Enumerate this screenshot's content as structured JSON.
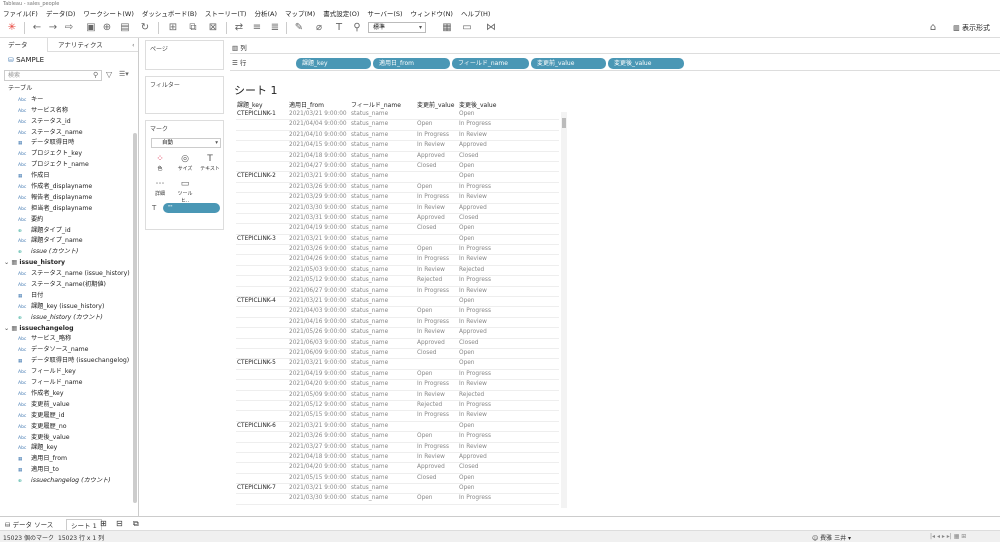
{
  "window_title": "Tableau - sales_people",
  "menu": [
    "ファイル(F)",
    "データ(D)",
    "ワークシート(W)",
    "ダッシュボード(B)",
    "ストーリー(T)",
    "分析(A)",
    "マップ(M)",
    "書式設定(O)",
    "サーバー(S)",
    "ウィンドウ(N)",
    "ヘルプ(H)"
  ],
  "toolbar": {
    "fit_select": "標準",
    "present_label": "表示形式"
  },
  "pane": {
    "tab_data": "データ",
    "tab_analytics": "アナリティクス",
    "datasource": "SAMPLE",
    "search_placeholder": "検索",
    "table_header": "テーブル"
  },
  "fields": [
    {
      "type": "Abc",
      "name": "キー",
      "indent": 1
    },
    {
      "type": "Abc",
      "name": "サービス名称",
      "indent": 1
    },
    {
      "type": "Abc",
      "name": "ステータス_id",
      "indent": 1
    },
    {
      "type": "Abc",
      "name": "ステータス_name",
      "indent": 1
    },
    {
      "type": "date",
      "name": "データ取得日時",
      "indent": 1
    },
    {
      "type": "Abc",
      "name": "プロジェクト_key",
      "indent": 1
    },
    {
      "type": "Abc",
      "name": "プロジェクト_name",
      "indent": 1
    },
    {
      "type": "date",
      "name": "作成日",
      "indent": 1
    },
    {
      "type": "Abc",
      "name": "作成者_displayname",
      "indent": 1
    },
    {
      "type": "Abc",
      "name": "報告者_displayname",
      "indent": 1
    },
    {
      "type": "Abc",
      "name": "担当者_displayname",
      "indent": 1
    },
    {
      "type": "Abc",
      "name": "要約",
      "indent": 1
    },
    {
      "type": "globe",
      "name": "課題タイプ_id",
      "indent": 1
    },
    {
      "type": "Abc",
      "name": "課題タイプ_name",
      "indent": 1
    },
    {
      "type": "count",
      "name": "issue (カウント)",
      "indent": 1,
      "italic": true
    },
    {
      "type": "group",
      "name": "issue_history"
    },
    {
      "type": "Abc",
      "name": "ステータス_name (issue_history)",
      "indent": 1
    },
    {
      "type": "Abc",
      "name": "ステータス_name(初期値)",
      "indent": 1
    },
    {
      "type": "date",
      "name": "日付",
      "indent": 1
    },
    {
      "type": "Abc",
      "name": "課題_key (issue_history)",
      "indent": 1
    },
    {
      "type": "count",
      "name": "issue_history (カウント)",
      "indent": 1,
      "italic": true
    },
    {
      "type": "group",
      "name": "issuechangelog"
    },
    {
      "type": "Abc",
      "name": "サービス_略称",
      "indent": 1
    },
    {
      "type": "Abc",
      "name": "データソース_name",
      "indent": 1
    },
    {
      "type": "date",
      "name": "データ取得日時 (issuechangelog)",
      "indent": 1
    },
    {
      "type": "Abc",
      "name": "フィールド_key",
      "indent": 1
    },
    {
      "type": "Abc",
      "name": "フィールド_name",
      "indent": 1
    },
    {
      "type": "Abc",
      "name": "作成者_key",
      "indent": 1
    },
    {
      "type": "Abc",
      "name": "変更前_value",
      "indent": 1
    },
    {
      "type": "Abc",
      "name": "変更履歴_id",
      "indent": 1
    },
    {
      "type": "Abc",
      "name": "変更履歴_no",
      "indent": 1
    },
    {
      "type": "Abc",
      "name": "変更後_value",
      "indent": 1
    },
    {
      "type": "Abc",
      "name": "課題_key",
      "indent": 1
    },
    {
      "type": "date",
      "name": "適用日_from",
      "indent": 1
    },
    {
      "type": "date",
      "name": "適用日_to",
      "indent": 1
    },
    {
      "type": "count",
      "name": "issuechangelog (カウント)",
      "indent": 1,
      "italic": true
    }
  ],
  "shelves": {
    "pages": "ページ",
    "filters": "フィルター",
    "marks": "マーク",
    "mark_type": "自動",
    "color": "色",
    "size": "サイズ",
    "text": "テキスト",
    "detail": "詳細",
    "tooltip": "ツールヒ..",
    "mark_pill": "\"\"",
    "columns": "列",
    "rows": "行"
  },
  "row_pills": [
    "課題_key",
    "適用日_from",
    "フィールド_name",
    "変更前_value",
    "変更後_value"
  ],
  "sheet_title": "シート 1",
  "headers": [
    "課題_key",
    "適用日_from",
    "フィールド_name",
    "変更前_value",
    "変更後_value"
  ],
  "groups": [
    {
      "key": "CTEPICLINK-1",
      "rows": [
        [
          "2021/03/21 9:00:00",
          "status_name",
          "",
          "Open"
        ],
        [
          "2021/04/04 9:00:00",
          "status_name",
          "Open",
          "In Progress"
        ],
        [
          "2021/04/10 9:00:00",
          "status_name",
          "In Progress",
          "In Review"
        ],
        [
          "2021/04/15 9:00:00",
          "status_name",
          "In Review",
          "Approved"
        ],
        [
          "2021/04/18 9:00:00",
          "status_name",
          "Approved",
          "Closed"
        ],
        [
          "2021/04/27 9:00:00",
          "status_name",
          "Closed",
          "Open"
        ]
      ]
    },
    {
      "key": "CTEPICLINK-2",
      "rows": [
        [
          "2021/03/21 9:00:00",
          "status_name",
          "",
          "Open"
        ],
        [
          "2021/03/26 9:00:00",
          "status_name",
          "Open",
          "In Progress"
        ],
        [
          "2021/03/29 9:00:00",
          "status_name",
          "In Progress",
          "In Review"
        ],
        [
          "2021/03/30 9:00:00",
          "status_name",
          "In Review",
          "Approved"
        ],
        [
          "2021/03/31 9:00:00",
          "status_name",
          "Approved",
          "Closed"
        ],
        [
          "2021/04/19 9:00:00",
          "status_name",
          "Closed",
          "Open"
        ]
      ]
    },
    {
      "key": "CTEPICLINK-3",
      "rows": [
        [
          "2021/03/21 9:00:00",
          "status_name",
          "",
          "Open"
        ],
        [
          "2021/03/26 9:00:00",
          "status_name",
          "Open",
          "In Progress"
        ],
        [
          "2021/04/26 9:00:00",
          "status_name",
          "In Progress",
          "In Review"
        ],
        [
          "2021/05/03 9:00:00",
          "status_name",
          "In Review",
          "Rejected"
        ],
        [
          "2021/05/12 9:00:00",
          "status_name",
          "Rejected",
          "In Progress"
        ],
        [
          "2021/06/27 9:00:00",
          "status_name",
          "In Progress",
          "In Review"
        ]
      ]
    },
    {
      "key": "CTEPICLINK-4",
      "rows": [
        [
          "2021/03/21 9:00:00",
          "status_name",
          "",
          "Open"
        ],
        [
          "2021/04/03 9:00:00",
          "status_name",
          "Open",
          "In Progress"
        ],
        [
          "2021/04/16 9:00:00",
          "status_name",
          "In Progress",
          "In Review"
        ],
        [
          "2021/05/26 9:00:00",
          "status_name",
          "In Review",
          "Approved"
        ],
        [
          "2021/06/03 9:00:00",
          "status_name",
          "Approved",
          "Closed"
        ],
        [
          "2021/06/09 9:00:00",
          "status_name",
          "Closed",
          "Open"
        ]
      ]
    },
    {
      "key": "CTEPICLINK-5",
      "rows": [
        [
          "2021/03/21 9:00:00",
          "status_name",
          "",
          "Open"
        ],
        [
          "2021/04/19 9:00:00",
          "status_name",
          "Open",
          "In Progress"
        ],
        [
          "2021/04/20 9:00:00",
          "status_name",
          "In Progress",
          "In Review"
        ],
        [
          "2021/05/09 9:00:00",
          "status_name",
          "In Review",
          "Rejected"
        ],
        [
          "2021/05/12 9:00:00",
          "status_name",
          "Rejected",
          "In Progress"
        ],
        [
          "2021/05/15 9:00:00",
          "status_name",
          "In Progress",
          "In Review"
        ]
      ]
    },
    {
      "key": "CTEPICLINK-6",
      "rows": [
        [
          "2021/03/21 9:00:00",
          "status_name",
          "",
          "Open"
        ],
        [
          "2021/03/26 9:00:00",
          "status_name",
          "Open",
          "In Progress"
        ],
        [
          "2021/03/27 9:00:00",
          "status_name",
          "In Progress",
          "In Review"
        ],
        [
          "2021/04/18 9:00:00",
          "status_name",
          "In Review",
          "Approved"
        ],
        [
          "2021/04/20 9:00:00",
          "status_name",
          "Approved",
          "Closed"
        ],
        [
          "2021/05/15 9:00:00",
          "status_name",
          "Closed",
          "Open"
        ]
      ]
    },
    {
      "key": "CTEPICLINK-7",
      "rows": [
        [
          "2021/03/21 9:00:00",
          "status_name",
          "",
          "Open"
        ],
        [
          "2021/03/30 9:00:00",
          "status_name",
          "Open",
          "In Progress"
        ]
      ]
    }
  ],
  "bottom_tabs": {
    "datasource": "データ ソース",
    "sheet": "シート 1"
  },
  "status": {
    "marks": "15023 個のマーク",
    "rowcol": "15023 行 x 1 列",
    "user": "費雅 三井"
  },
  "colors": {
    "pill": "#4a97b5",
    "accent": "#e8453c"
  }
}
